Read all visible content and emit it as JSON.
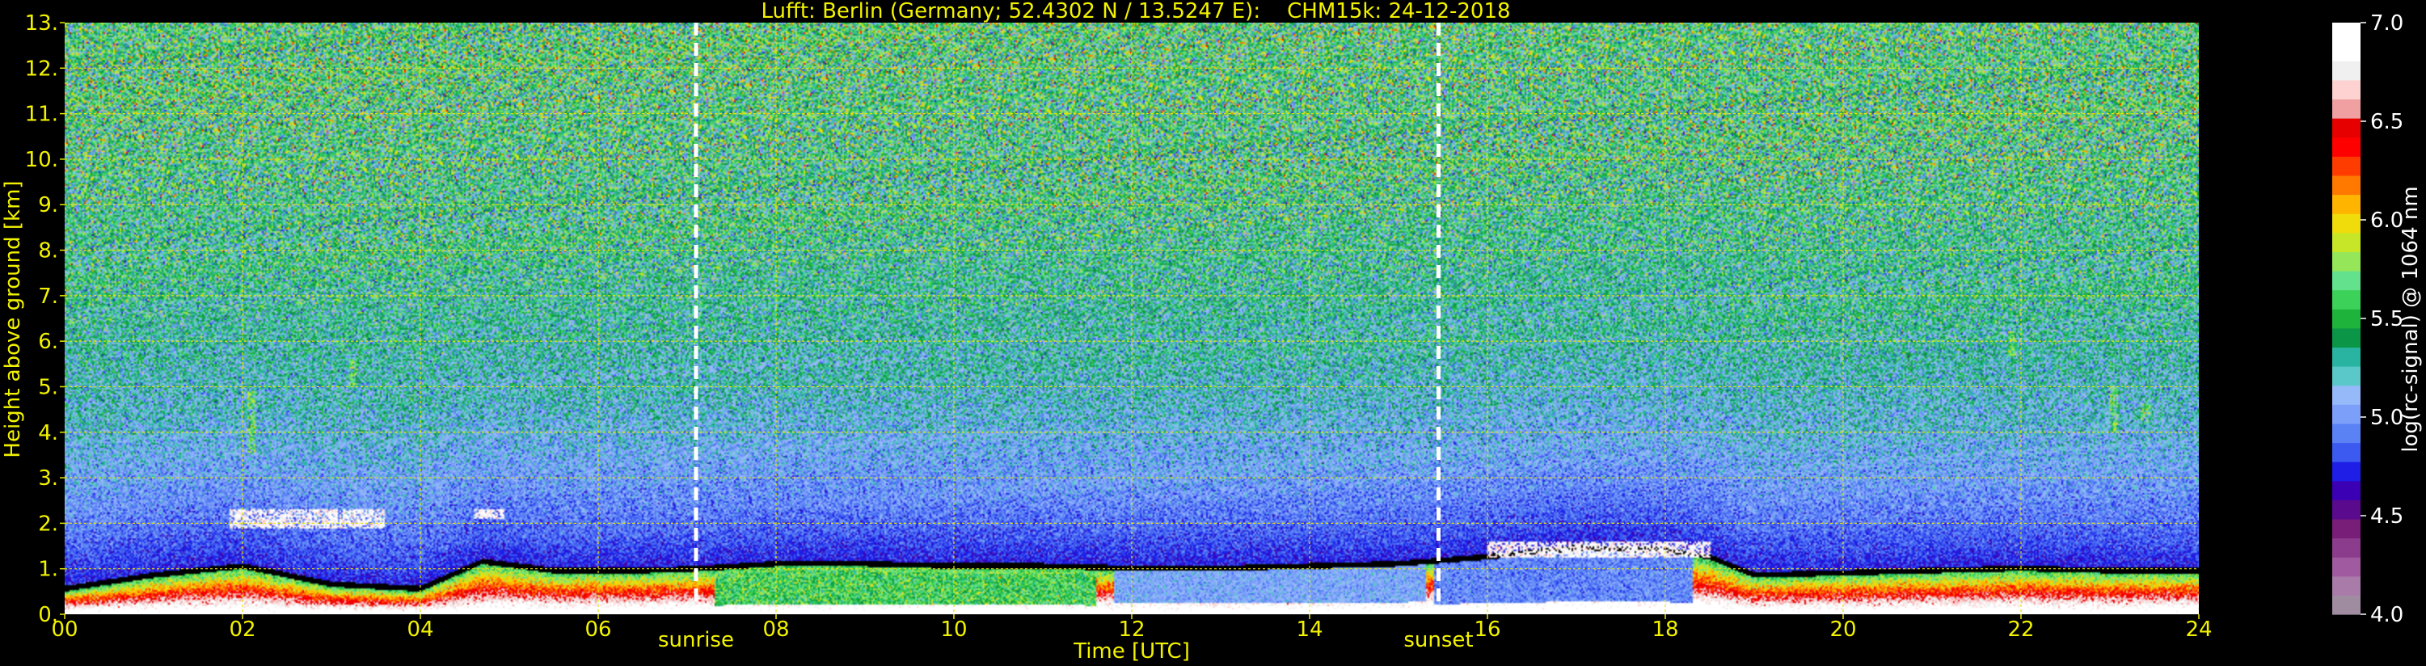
{
  "chart_data": {
    "type": "heatmap",
    "title": "Lufft: Berlin (Germany; 52.4302 N / 13.5247 E):    CHM15k: 24-12-2018",
    "xlabel": "Time [UTC]",
    "ylabel": "Height above ground [km]",
    "xlim": [
      0,
      24
    ],
    "ylim": [
      0,
      13
    ],
    "xticks": [
      {
        "value": 0,
        "label": "00"
      },
      {
        "value": 2,
        "label": "02"
      },
      {
        "value": 4,
        "label": "04"
      },
      {
        "value": 6,
        "label": "06"
      },
      {
        "value": 8,
        "label": "08"
      },
      {
        "value": 10,
        "label": "10"
      },
      {
        "value": 12,
        "label": "12"
      },
      {
        "value": 14,
        "label": "14"
      },
      {
        "value": 16,
        "label": "16"
      },
      {
        "value": 18,
        "label": "18"
      },
      {
        "value": 20,
        "label": "20"
      },
      {
        "value": 22,
        "label": "22"
      },
      {
        "value": 24,
        "label": "24"
      }
    ],
    "yticks": [
      {
        "value": 0,
        "label": "0."
      },
      {
        "value": 1,
        "label": "1."
      },
      {
        "value": 2,
        "label": "2."
      },
      {
        "value": 3,
        "label": "3."
      },
      {
        "value": 4,
        "label": "4."
      },
      {
        "value": 5,
        "label": "5."
      },
      {
        "value": 6,
        "label": "6."
      },
      {
        "value": 7,
        "label": "7."
      },
      {
        "value": 8,
        "label": "8."
      },
      {
        "value": 9,
        "label": "9."
      },
      {
        "value": 10,
        "label": "10."
      },
      {
        "value": 11,
        "label": "11."
      },
      {
        "value": 12,
        "label": "12."
      },
      {
        "value": 13,
        "label": "13."
      }
    ],
    "grid": true,
    "annotations": [
      {
        "text": "sunrise",
        "x": 7.1
      },
      {
        "text": "sunset",
        "x": 15.45
      }
    ],
    "colorbar": {
      "label": "log(rc-signal) @ 1064 nm",
      "range": [
        4.0,
        7.0
      ],
      "ticks": [
        {
          "value": 4.0,
          "label": "4.0"
        },
        {
          "value": 4.5,
          "label": "4.5"
        },
        {
          "value": 5.0,
          "label": "5.0"
        },
        {
          "value": 5.5,
          "label": "5.5"
        },
        {
          "value": 6.0,
          "label": "6.0"
        },
        {
          "value": 6.5,
          "label": "6.5"
        },
        {
          "value": 7.0,
          "label": "7.0"
        }
      ],
      "colors": [
        "#a08ca0",
        "#a97ba9",
        "#a05aa0",
        "#8c3c8c",
        "#781e78",
        "#5a0a8c",
        "#3c00b4",
        "#1e1ee6",
        "#3c5af0",
        "#5a82f5",
        "#7ca0fa",
        "#96b9fa",
        "#5ac8c8",
        "#28b4a0",
        "#0a9646",
        "#1eb43c",
        "#3cd25a",
        "#64e18c",
        "#96e65a",
        "#c8e628",
        "#f0dc0a",
        "#ffb400",
        "#ff7800",
        "#ff3c00",
        "#ff0000",
        "#e60000",
        "#f0a0a0",
        "#ffd2d2",
        "#f0f0f0",
        "#ffffff",
        "#ffffff"
      ]
    },
    "layers": {
      "mixing_layer_top_km": [
        [
          0,
          0.5
        ],
        [
          1,
          0.8
        ],
        [
          2,
          1.0
        ],
        [
          3,
          0.6
        ],
        [
          4,
          0.5
        ],
        [
          4.7,
          1.1
        ],
        [
          5.5,
          0.9
        ],
        [
          6.5,
          0.9
        ],
        [
          7.2,
          0.95
        ],
        [
          8,
          1.05
        ],
        [
          9,
          1.05
        ],
        [
          10,
          1.0
        ],
        [
          11,
          1.0
        ],
        [
          12,
          0.95
        ],
        [
          13,
          0.95
        ],
        [
          14,
          1.0
        ],
        [
          15,
          1.05
        ],
        [
          16,
          1.2
        ],
        [
          17,
          1.4
        ],
        [
          18,
          1.35
        ],
        [
          18.5,
          1.2
        ],
        [
          19,
          0.8
        ],
        [
          20,
          0.85
        ],
        [
          21,
          0.9
        ],
        [
          22,
          0.95
        ],
        [
          23,
          0.9
        ],
        [
          24,
          0.9
        ]
      ],
      "lofted_layers": [
        {
          "x0": 1.85,
          "x1": 3.6,
          "y0": 1.9,
          "y1": 2.3
        },
        {
          "x0": 4.6,
          "x1": 4.95,
          "y0": 2.1,
          "y1": 2.3
        },
        {
          "x0": 16.0,
          "x1": 18.5,
          "y0": 1.25,
          "y1": 1.6
        }
      ],
      "elevated_features": [
        {
          "x": 2.1,
          "y0": 3.5,
          "y1": 4.9
        },
        {
          "x": 3.25,
          "y0": 5.0,
          "y1": 5.6
        },
        {
          "x": 21.9,
          "y0": 5.7,
          "y1": 6.2
        },
        {
          "x": 23.05,
          "y0": 4.0,
          "y1": 5.0
        },
        {
          "x": 23.4,
          "y0": 4.2,
          "y1": 4.6
        }
      ]
    }
  }
}
